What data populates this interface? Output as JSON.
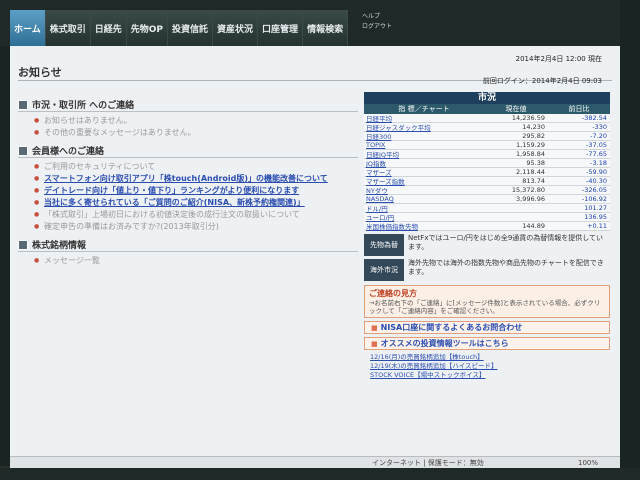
{
  "nav": {
    "tabs": [
      "ホーム",
      "株式取引",
      "日経先",
      "先物OP",
      "投資信託",
      "資産状況",
      "口座管理",
      "情報検索"
    ],
    "extra": [
      "ヘルプ",
      "ログアウト"
    ]
  },
  "page": {
    "title": "お知らせ",
    "date": "2014年2月4日 12:00 現在",
    "last_login": "前回ログイン：2014年2月4日 09:03"
  },
  "sections": [
    {
      "heading": "市況・取引所 へのご連絡",
      "items": [
        {
          "text": "お知らせはありません。",
          "style": "plain"
        },
        {
          "text": "その他の重要なメッセージはありません。",
          "style": "plain"
        }
      ]
    },
    {
      "heading": "会員様へのご連絡",
      "items": [
        {
          "text": "ご利用のセキュリティについて",
          "style": "plain"
        },
        {
          "text": "スマートフォン向け取引アプリ「株touch(Android版)」の機能改善について",
          "style": "link"
        },
        {
          "text": "デイトレード向け「値上り・値下り」ランキングがより便利になります",
          "style": "link"
        },
        {
          "text": "当社に多く寄せられている「ご質問のご紹介(NISA、新株予約権関連)」",
          "style": "link"
        },
        {
          "text": "「株式取引」上場初日における初値決定後の成行注文の取扱いについて",
          "style": "plain"
        },
        {
          "text": "確定申告の準備はお済みですか?(2013年取引分)",
          "style": "plain"
        }
      ]
    },
    {
      "heading": "株式銘柄情報",
      "items": [
        {
          "text": "メッセージ一覧",
          "style": "plain"
        }
      ]
    }
  ],
  "market": {
    "title": "市況",
    "col_name": "指 標／チャート",
    "col_price": "現在値",
    "col_change": "前日比",
    "rows": [
      {
        "name": "日経平均",
        "price": "14,236.59",
        "change": "-382.54"
      },
      {
        "name": "日経ジャスダック平均",
        "price": "14,230",
        "change": "-330"
      },
      {
        "name": "日経300",
        "price": "295.82",
        "change": "-7.20"
      },
      {
        "name": "TOPIX",
        "price": "1,159.29",
        "change": "-37.05"
      },
      {
        "name": "日経JQ平均",
        "price": "1,958.84",
        "change": "-77.65"
      },
      {
        "name": "JQ指数",
        "price": "95.38",
        "change": "-3.18"
      },
      {
        "name": "マザーズ",
        "price": "2,118.44",
        "change": "-59.90"
      },
      {
        "name": "マザーズ指数",
        "price": "813.74",
        "change": "-40.30"
      },
      {
        "name": "NYダウ",
        "price": "15,372.80",
        "change": "-326.05"
      },
      {
        "name": "NASDAQ",
        "price": "3,996.96",
        "change": "-106.92"
      },
      {
        "name": "ドル/円",
        "price": "",
        "change": "101.27"
      },
      {
        "name": "ユーロ/円",
        "price": "",
        "change": "136.95"
      },
      {
        "name": "米国株価指数先物",
        "price": "144.89",
        "change": "+0.11"
      }
    ]
  },
  "info": [
    {
      "label": "先物為替",
      "text": "NetFxではユーロ/円をはじめ全9通貨の為替情報を提供しています。"
    },
    {
      "label": "海外市況",
      "text": "海外先物では海外の指数先物や商品先物のチャートを配信できます。"
    }
  ],
  "notice": {
    "heading": "ご連絡の見方",
    "text": "→お名前右下の「ご連絡」に[メッセージ件数]と表示されている場合、必ずクリックして「ご連絡内容」をご確認ください。"
  },
  "bars": [
    "NISA口座に関するよくあるお問合わせ",
    "オススメの投資情報ツールはこちら"
  ],
  "news": [
    "12/16(月)の売買銘柄追加【株touch】",
    "12/19(木)の売買銘柄追加【ハイスピード】",
    "STOCK VOICE【場中ストックボイス】"
  ],
  "status": {
    "zone": "インターネット | 保護モード：無効",
    "zoom": "100%"
  }
}
